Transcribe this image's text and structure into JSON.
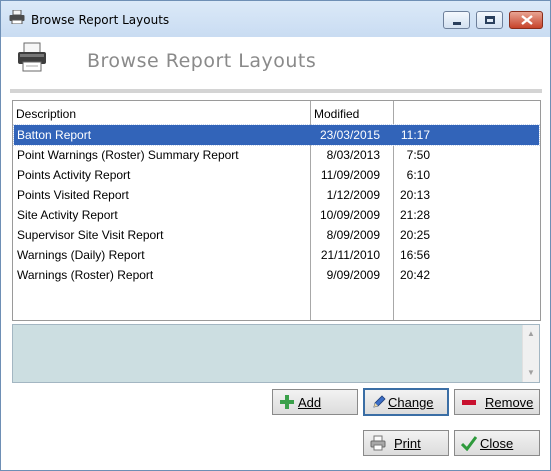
{
  "window": {
    "title": "Browse Report Layouts"
  },
  "header": {
    "title": "Browse Report Layouts"
  },
  "table": {
    "columns": [
      "Description",
      "Modified",
      ""
    ],
    "selected_index": 0,
    "rows": [
      {
        "description": "Batton Report",
        "date": "23/03/2015",
        "time": "11:17"
      },
      {
        "description": "Point Warnings (Roster) Summary Report",
        "date": "8/03/2013",
        "time": "7:50"
      },
      {
        "description": "Points Activity Report",
        "date": "11/09/2009",
        "time": "6:10"
      },
      {
        "description": "Points Visited Report",
        "date": "1/12/2009",
        "time": "20:13"
      },
      {
        "description": "Site Activity Report",
        "date": "10/09/2009",
        "time": "21:28"
      },
      {
        "description": "Supervisor Site Visit Report",
        "date": "8/09/2009",
        "time": "20:25"
      },
      {
        "description": "Warnings (Daily) Report",
        "date": "21/11/2010",
        "time": "16:56"
      },
      {
        "description": "Warnings (Roster) Report",
        "date": "9/09/2009",
        "time": "20:42"
      }
    ]
  },
  "buttons": {
    "add": "Add",
    "change": "Change",
    "remove": "Remove",
    "print": "Print",
    "close": "Close"
  },
  "colors": {
    "selection": "#3264b9",
    "memo_background": "#ccdee1",
    "add_icon": "#3aa04a",
    "remove_icon": "#c8102e",
    "close_icon": "#2e9a3c"
  },
  "icons": {
    "title": "printer-icon",
    "header": "printer-icon",
    "add": "plus-icon",
    "change": "pencil-icon",
    "remove": "minus-icon",
    "print": "printer-icon",
    "close": "checkmark-icon"
  }
}
